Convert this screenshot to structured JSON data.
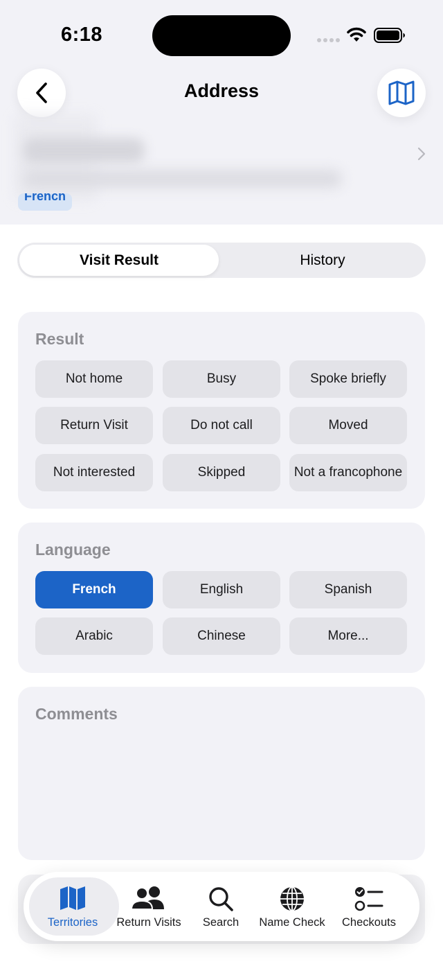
{
  "status_bar": {
    "time": "6:18"
  },
  "nav": {
    "title": "Address",
    "back_icon": "chevron-left-icon",
    "map_icon": "map-icon"
  },
  "address_card": {
    "language_badge": "French"
  },
  "segmented": {
    "tabs": [
      "Visit Result",
      "History"
    ],
    "selected": "Visit Result"
  },
  "result": {
    "title": "Result",
    "options": [
      "Not home",
      "Busy",
      "Spoke briefly",
      "Return Visit",
      "Do not call",
      "Moved",
      "Not interested",
      "Skipped",
      "Not a francophone"
    ]
  },
  "language": {
    "title": "Language",
    "options": [
      "French",
      "English",
      "Spanish",
      "Arabic",
      "Chinese",
      "More..."
    ],
    "selected": "French"
  },
  "comments": {
    "title": "Comments"
  },
  "tabbar": {
    "items": [
      {
        "label": "Territories",
        "icon": "map-icon",
        "active": true
      },
      {
        "label": "Return Visits",
        "icon": "people-icon",
        "active": false
      },
      {
        "label": "Search",
        "icon": "search-icon",
        "active": false
      },
      {
        "label": "Name Check",
        "icon": "globe-icon",
        "active": false
      },
      {
        "label": "Checkouts",
        "icon": "checklist-icon",
        "active": false
      }
    ]
  },
  "colors": {
    "accent": "#1c64c7",
    "card_bg": "#f2f2f7",
    "chip_bg": "#e3e3e8"
  }
}
